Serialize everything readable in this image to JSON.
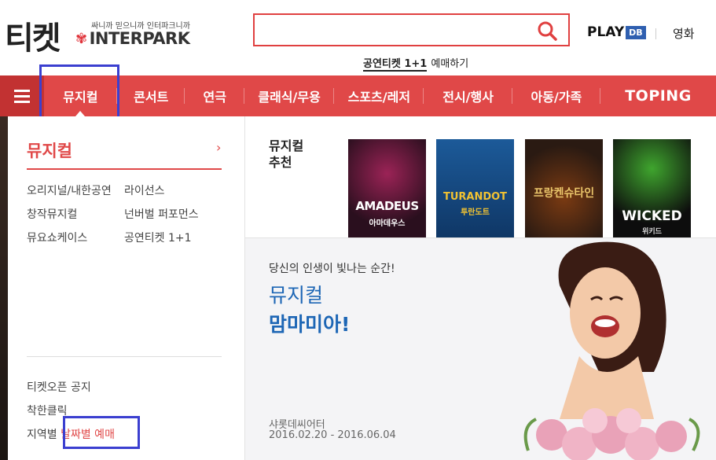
{
  "header": {
    "logo_ticket": "티켓",
    "logo_tagline": "싸니까 믿으니까 인터파크니까",
    "logo_brand": "INTERPARK",
    "search_placeholder": "",
    "promo_bold": "공연티켓 1+1",
    "promo_sub": "예매하기",
    "playdb_play": "PLAY",
    "playdb_db": "DB",
    "movie_link": "영화"
  },
  "nav": {
    "items": [
      {
        "label": "뮤지컬"
      },
      {
        "label": "콘서트"
      },
      {
        "label": "연극"
      },
      {
        "label": "클래식/무용"
      },
      {
        "label": "스포츠/레저"
      },
      {
        "label": "전시/행사"
      },
      {
        "label": "아동/가족"
      }
    ],
    "toping": "TOPING"
  },
  "sidebar": {
    "title": "뮤지컬",
    "arrow": "›",
    "categories": [
      "오리지널/내한공연",
      "라이선스",
      "창작뮤지컬",
      "넌버벌 퍼포먼스",
      "뮤요쇼케이스",
      "공연티켓 1+1"
    ],
    "links": {
      "ticket_open": "티켓오픈 공지",
      "good_click": "착한클릭",
      "region_prefix": "지역별",
      "date_booking": "날짜별 예매"
    }
  },
  "recommend": {
    "title_line1": "뮤지컬",
    "title_line2": "추천",
    "posters": [
      {
        "title": "AMADEUS",
        "sub": "아마데우스",
        "bg": "#2a0f1e"
      },
      {
        "title": "TURANDOT",
        "sub": "투란도트",
        "bg": "#1c5a99"
      },
      {
        "title": "프랑켄슈타인",
        "sub": "",
        "bg": "#2a1a12"
      },
      {
        "title": "WICKED",
        "sub": "위키드",
        "bg": "#0d0d0d"
      }
    ]
  },
  "banner": {
    "subtitle": "당신의 인생이 빛나는 순간!",
    "title1": "뮤지컬",
    "title2": "맘마미아!",
    "venue": "샤롯데씨어터",
    "dates": "2016.02.20 - 2016.06.04"
  },
  "colors": {
    "brand_red": "#e04848",
    "highlight_box": "#3b3fd0",
    "banner_blue": "#1d66b5"
  }
}
